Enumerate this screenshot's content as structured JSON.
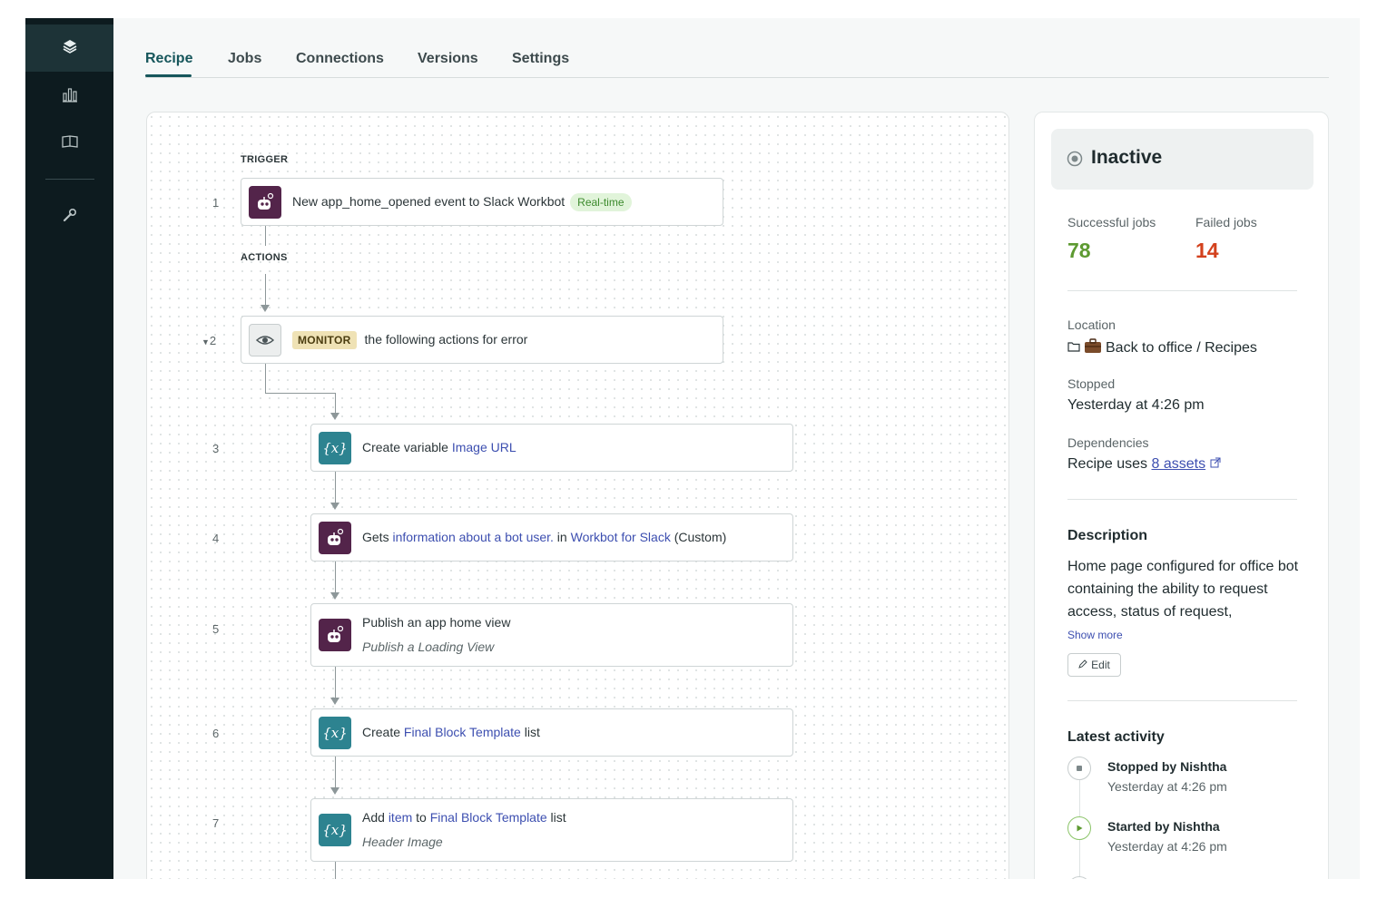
{
  "sidebar": {
    "items": [
      {
        "icon": "layers-icon",
        "active": true
      },
      {
        "icon": "bar-chart-icon",
        "active": false
      },
      {
        "icon": "book-icon",
        "active": false
      },
      {
        "icon": "wrench-icon",
        "active": false
      }
    ]
  },
  "tabs": [
    {
      "label": "Recipe",
      "active": true
    },
    {
      "label": "Jobs",
      "active": false
    },
    {
      "label": "Connections",
      "active": false
    },
    {
      "label": "Versions",
      "active": false
    },
    {
      "label": "Settings",
      "active": false
    }
  ],
  "recipe": {
    "trigger_label": "TRIGGER",
    "actions_label": "ACTIONS",
    "steps": [
      {
        "num": "1",
        "icon": "slack-bot-icon",
        "text": "New app_home_opened event to Slack Workbot",
        "badge": "Real-time"
      },
      {
        "num": "2",
        "icon": "eye-icon",
        "badge": "MONITOR",
        "text": "the following actions for error"
      },
      {
        "num": "3",
        "icon": "variable-icon",
        "icon_text": "{x}",
        "text_pre": "Create variable ",
        "text_link": "Image URL"
      },
      {
        "num": "4",
        "icon": "slack-bot-icon",
        "text_pre": "Gets ",
        "text_link": "information about a bot user.",
        "text_mid": " in ",
        "text_link2": "Workbot for Slack",
        "text_post": " (Custom)"
      },
      {
        "num": "5",
        "icon": "slack-bot-icon",
        "text": "Publish an app home view",
        "subtext": "Publish a Loading View"
      },
      {
        "num": "6",
        "icon": "variable-icon",
        "icon_text": "{x}",
        "text_pre": "Create ",
        "text_link": "Final Block Template",
        "text_post": " list"
      },
      {
        "num": "7",
        "icon": "variable-icon",
        "icon_text": "{x}",
        "text_pre": "Add ",
        "text_link": "item",
        "text_mid": " to ",
        "text_link2": "Final Block Template",
        "text_post": " list",
        "subtext": "Header Image"
      }
    ]
  },
  "panel": {
    "status": "Inactive",
    "successful_label": "Successful jobs",
    "successful_value": "78",
    "failed_label": "Failed jobs",
    "failed_value": "14",
    "location_label": "Location",
    "location_value": "Back to office / Recipes",
    "stopped_label": "Stopped",
    "stopped_value": "Yesterday at 4:26 pm",
    "dependencies_label": "Dependencies",
    "dependencies_pre": "Recipe uses ",
    "dependencies_link": "8 assets",
    "description_heading": "Description",
    "description_text": "Home page configured for office bot containing the ability to request access, status of request,",
    "show_more": "Show more",
    "edit_label": "Edit",
    "activity_heading": "Latest activity",
    "activity": [
      {
        "title": "Stopped by Nishtha",
        "time": "Yesterday at 4:26 pm",
        "icon": "stop-icon"
      },
      {
        "title": "Started by Nishtha",
        "time": "Yesterday at 4:26 pm",
        "icon": "play-icon"
      }
    ]
  },
  "colors": {
    "accent": "#16565b",
    "sidebar_bg": "#0d1b1f",
    "link": "#3d4fb0",
    "success": "#5d9a31",
    "failure": "#d3411d",
    "slack_icon_bg": "#53244a",
    "variable_icon_bg": "#2d8390"
  }
}
